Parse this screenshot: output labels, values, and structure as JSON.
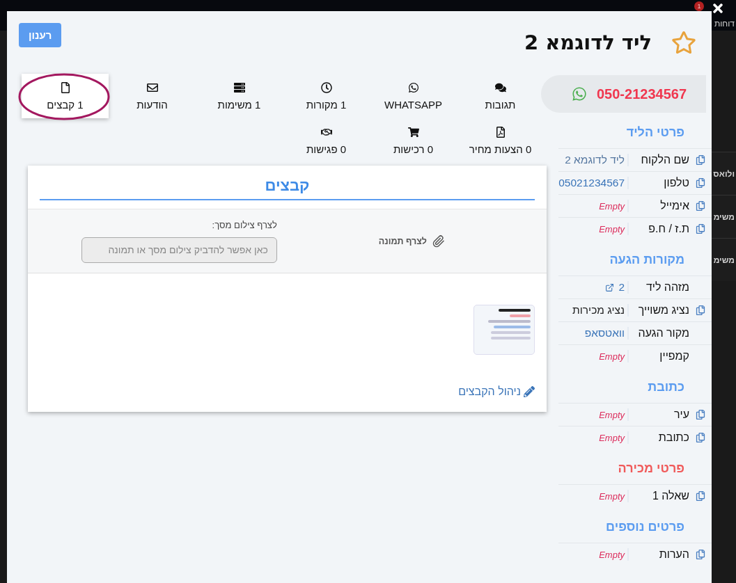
{
  "background_page": {
    "menu_label": "דוחות",
    "notification_count": "1",
    "row_labels": [
      "ולואס",
      "משימ",
      "משימ"
    ]
  },
  "header": {
    "title": "ליד לדוגמא 2",
    "starred": false,
    "refresh_button": "רענון"
  },
  "phone": "050-21234567",
  "tabs": [
    {
      "label": "תגובות",
      "selected": false
    },
    {
      "label": "WHATSAPP",
      "selected": false
    },
    {
      "label": "1 מקורות",
      "selected": false
    },
    {
      "label": "1 משימות",
      "selected": false
    },
    {
      "label": "הודעות",
      "selected": false
    },
    {
      "label": "1 קבצים",
      "selected": true
    },
    {
      "label": "0 הצעות מחיר",
      "selected": false
    },
    {
      "label": "0 רכישות",
      "selected": false
    },
    {
      "label": "0 פגישות",
      "selected": false
    }
  ],
  "files_panel": {
    "title": "קבצים",
    "attach_label": "לצרף תמונה",
    "paste_label": "לצרף צילום מסך:",
    "paste_placeholder": "כאן אפשר להדביק צילום מסך או תמונה",
    "manage_link": "ניהול הקבצים"
  },
  "sections": [
    {
      "title": "פרטי הליד",
      "color": "#5b9cf0",
      "rows": [
        {
          "label": "שם הלקוח",
          "value": "ליד לדוגמא 2",
          "kind": "text",
          "copyable": true
        },
        {
          "label": "טלפון",
          "value": "05021234567",
          "kind": "link",
          "copyable": true
        },
        {
          "label": "אימייל",
          "value": "Empty",
          "kind": "empty",
          "copyable": true
        },
        {
          "label": "ת.ז / ח.פ",
          "value": "Empty",
          "kind": "empty",
          "copyable": true
        }
      ]
    },
    {
      "title": "מקורות הגעה",
      "color": "#5b9cf0",
      "rows": [
        {
          "label": "מזהה ליד",
          "value": "2",
          "kind": "external",
          "copyable": false
        },
        {
          "label": "נציג משוייך",
          "value": "נציג מכירות",
          "kind": "plain",
          "copyable": true
        },
        {
          "label": "מקור הגעה",
          "value": "וואטסאפ",
          "kind": "link",
          "copyable": false
        },
        {
          "label": "קמפיין",
          "value": "Empty",
          "kind": "empty",
          "copyable": false
        }
      ]
    },
    {
      "title": "כתובת",
      "color": "#5b9cf0",
      "rows": [
        {
          "label": "עיר",
          "value": "Empty",
          "kind": "empty",
          "copyable": true
        },
        {
          "label": "כתובת",
          "value": "Empty",
          "kind": "empty",
          "copyable": true
        }
      ]
    },
    {
      "title": "פרטי מכירה",
      "color": "#f05a5a",
      "rows": [
        {
          "label": "שאלה 1",
          "value": "Empty",
          "kind": "empty",
          "copyable": true
        }
      ]
    },
    {
      "title": "פרטים נוספים",
      "color": "#5b9cf0",
      "rows": [
        {
          "label": "הערות",
          "value": "Empty",
          "kind": "empty",
          "copyable": true
        }
      ]
    }
  ]
}
